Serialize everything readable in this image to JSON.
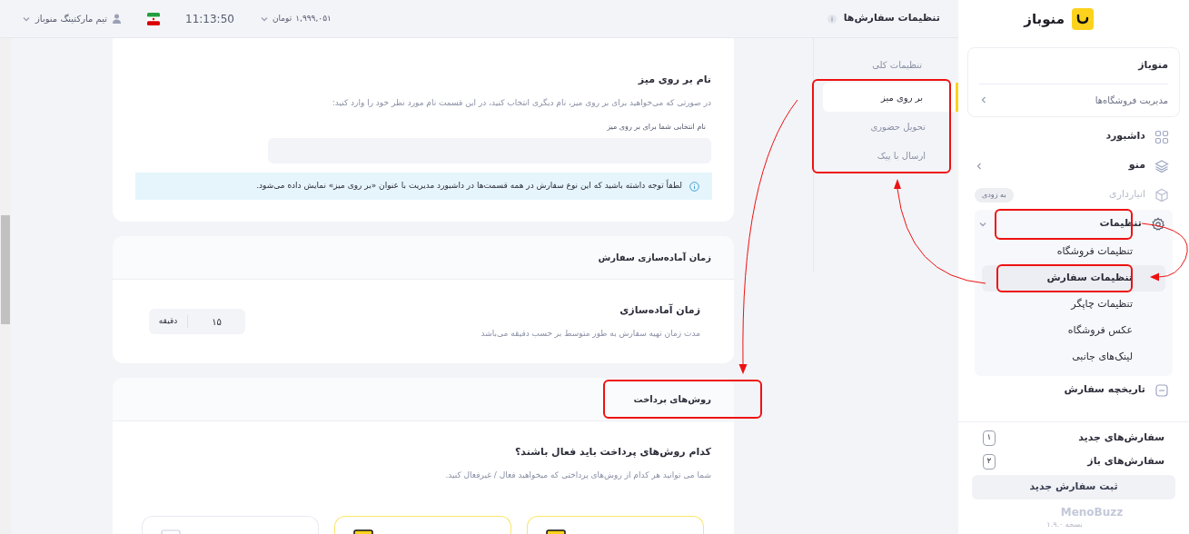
{
  "topbar": {
    "page_title": "تنظیمات سفارش‌ها",
    "balance": "۱,۹۹۹,۰۵۱",
    "currency": "تومان",
    "time": "11:13:50",
    "user": "تیم مارکتینگ منوباز"
  },
  "sidebar": {
    "brand": "منوباز",
    "store": {
      "name": "منوباز",
      "manage_link": "مدیریت فروشگاه‌ها"
    },
    "items": [
      {
        "label": "داشبورد",
        "disabled": false
      },
      {
        "label": "منو",
        "disabled": false,
        "expanded": false
      },
      {
        "label": "انبارداری",
        "disabled": true,
        "badge": "به زودی"
      },
      {
        "label": "تنظیمات",
        "disabled": false,
        "expanded": true,
        "children": [
          {
            "label": "تنظیمات فروشگاه",
            "selected": false
          },
          {
            "label": "تنظیمات سفارش",
            "selected": true
          },
          {
            "label": "تنظیمات چاپگر",
            "selected": false
          },
          {
            "label": "عکس فروشگاه",
            "selected": false
          },
          {
            "label": "لینک‌های جانبی",
            "selected": false
          }
        ]
      },
      {
        "label": "تاریخچه سفارش",
        "disabled": false
      }
    ],
    "counters": [
      {
        "label": "سفارش‌های جدید",
        "count": "۱"
      },
      {
        "label": "سفارش‌های باز",
        "count": "۲"
      }
    ],
    "new_order_button": "ثبت سفارش جدید",
    "product": "MenoBuzz",
    "version": "نسخه ۱.۹.۰"
  },
  "settings_nav": {
    "heading": "تنظیمات کلی",
    "items": [
      {
        "label": "بر روی میز",
        "selected": true
      },
      {
        "label": "تحویل حضوری",
        "selected": false
      },
      {
        "label": "ارسال با پیک",
        "selected": false
      }
    ]
  },
  "table_name_card": {
    "title": "نام بر روی میز",
    "description": "در صورتی که می‌خواهید برای بر روی میز، نام دیگری انتخاب کنید، در این قسمت نام مورد نظر خود را وارد کنید:",
    "field_label": "نام انتخابی شما برای بر روی میز",
    "notice": "لطفاً توجه داشته باشید که این نوع سفارش در همه قسمت‌ها در داشبورد مدیریت با عنوان «بر روی میز» نمایش داده می‌شود."
  },
  "prep_card": {
    "header": "زمان آماده‌سازی سفارش",
    "title": "زمان آماده‌سازی",
    "description": "مدت زمان تهیه سفارش به طور متوسط بر حسب دقیقه می‌باشد",
    "value": "۱۵",
    "unit": "دقیقه"
  },
  "payment_card": {
    "header": "روش‌های پرداخت",
    "question": "کدام روش‌های پرداخت باید فعال باشند؟",
    "description": "شما می توانید هر کدام از روش‌های پرداختی که میخواهید فعال / غیرفعال کنید.",
    "methods": [
      {
        "enabled": true
      },
      {
        "enabled": true
      },
      {
        "enabled": false
      }
    ]
  }
}
